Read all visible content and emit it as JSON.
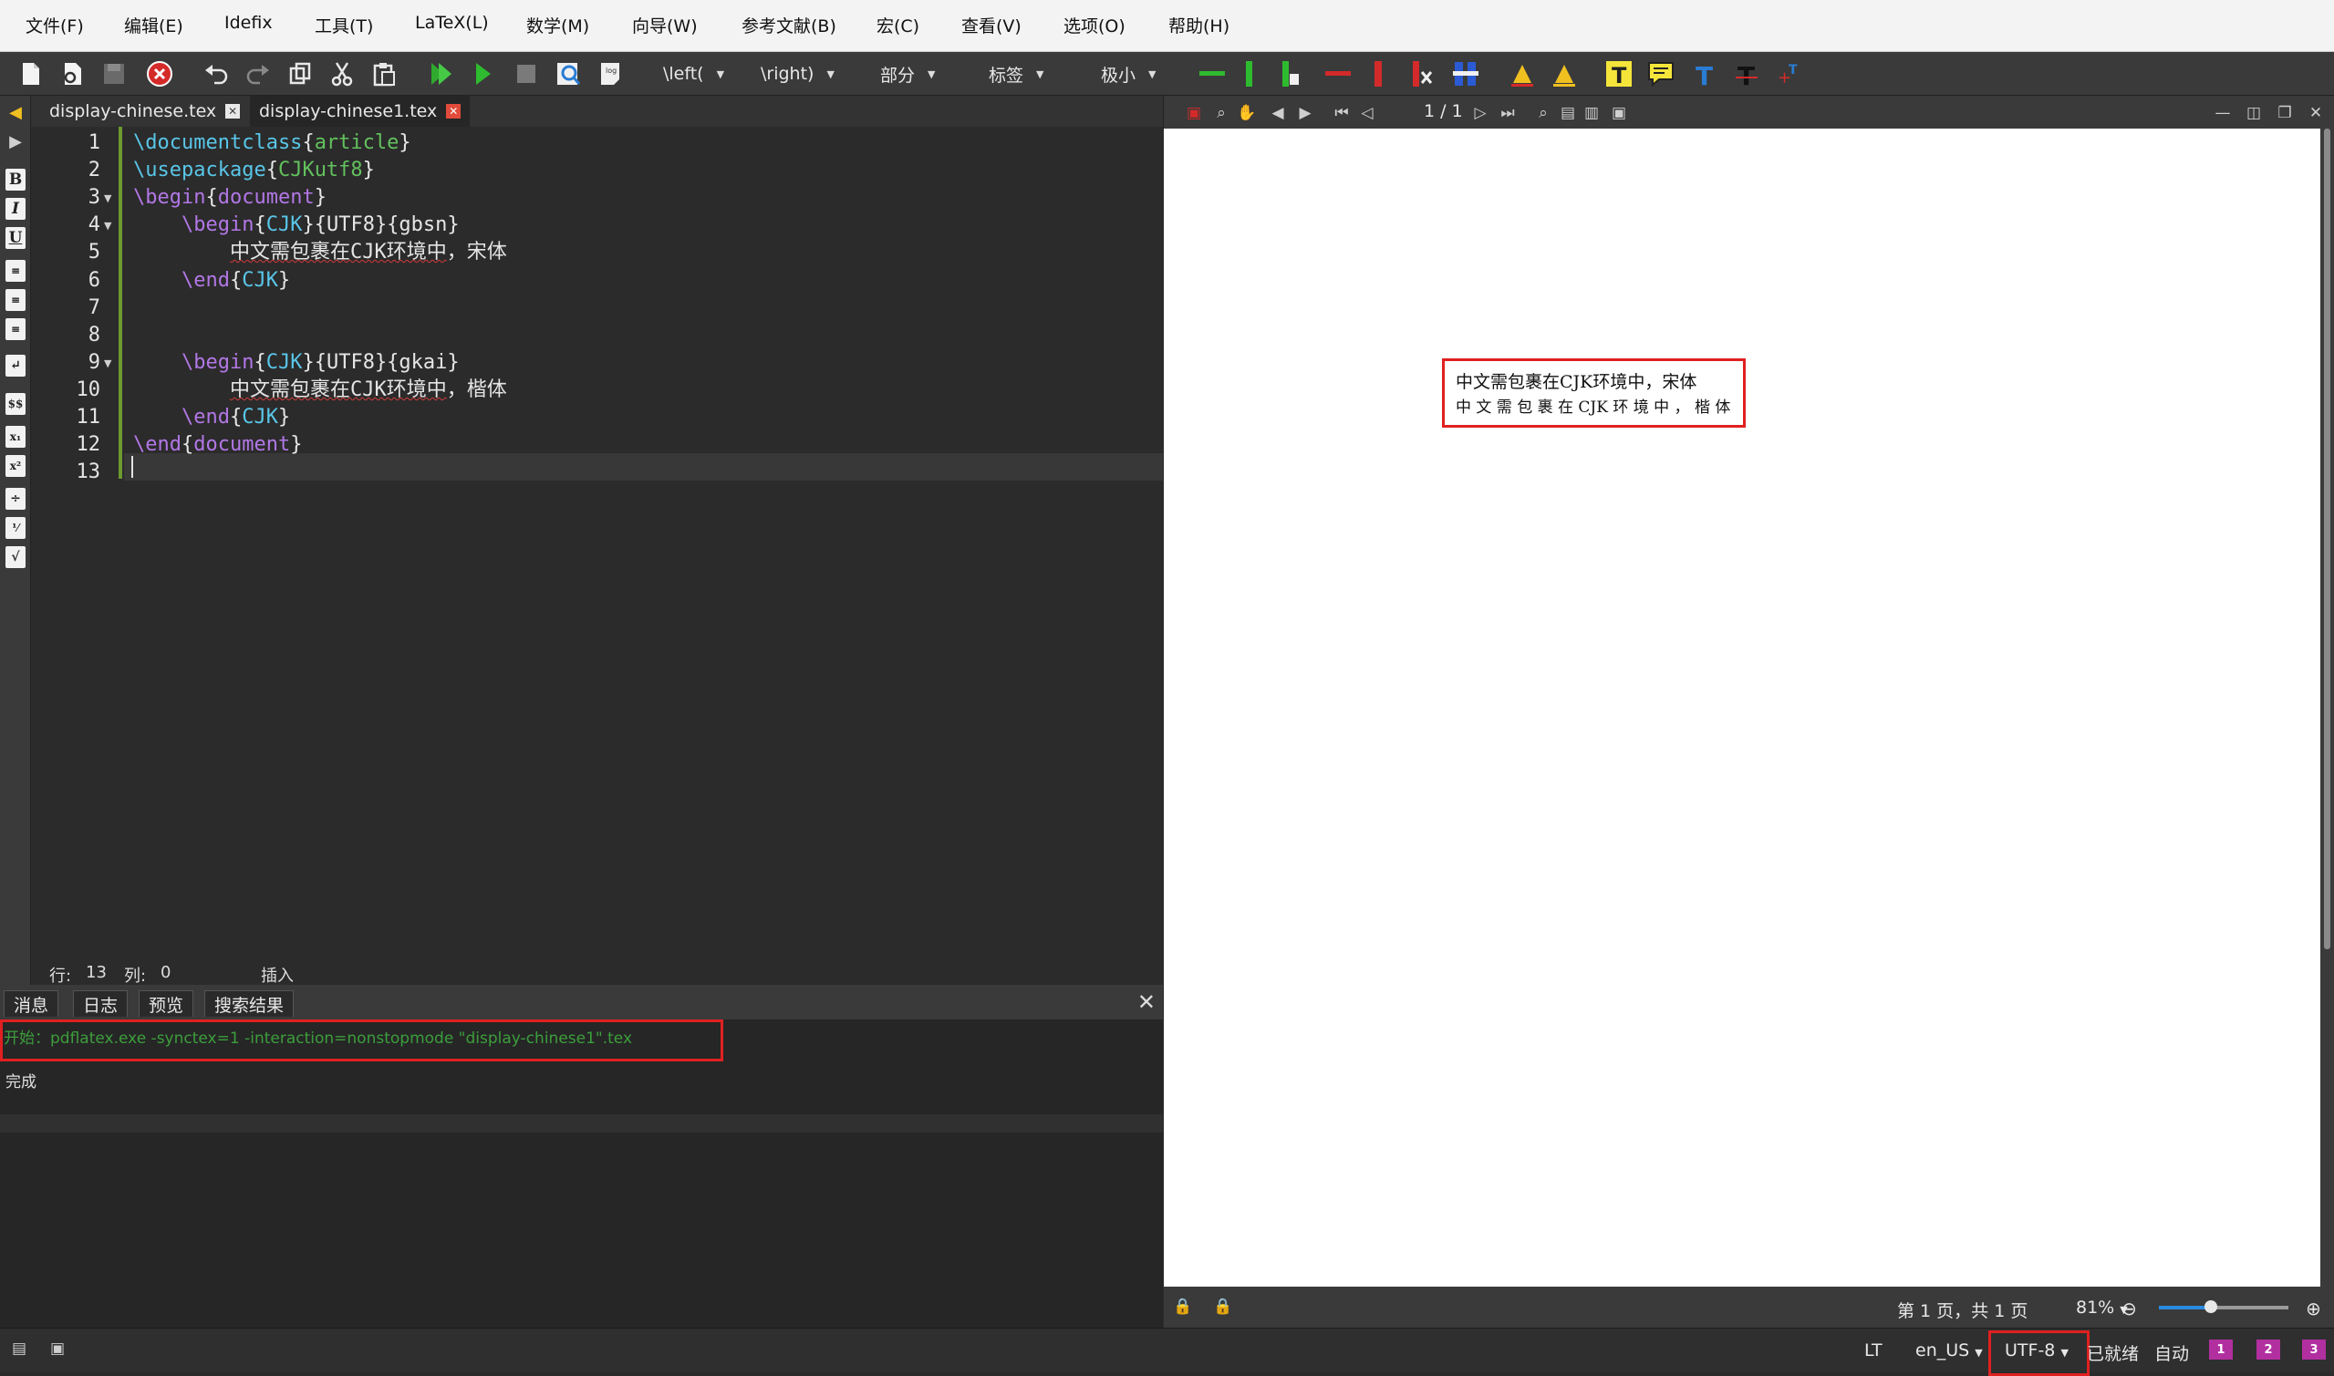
{
  "menu": [
    "文件(F)",
    "编辑(E)",
    "Idefix",
    "工具(T)",
    "LaTeX(L)",
    "数学(M)",
    "向导(W)",
    "参考文献(B)",
    "宏(C)",
    "查看(V)",
    "选项(O)",
    "帮助(H)"
  ],
  "toolbar": {
    "combos": [
      "\\left(",
      "\\right)",
      "部分",
      "标签",
      "极小"
    ]
  },
  "tabs": [
    {
      "label": "display-chinese.tex",
      "active": false
    },
    {
      "label": "display-chinese1.tex",
      "active": true
    }
  ],
  "editor": {
    "line_numbers": [
      "1",
      "2",
      "3",
      "4",
      "5",
      "6",
      "7",
      "8",
      "9",
      "10",
      "11",
      "12",
      "13"
    ],
    "lines": [
      [
        {
          "t": "\\documentclass",
          "c": "cmd"
        },
        {
          "t": "{",
          "c": "brk"
        },
        {
          "t": "article",
          "c": "arg"
        },
        {
          "t": "}",
          "c": "brk"
        }
      ],
      [
        {
          "t": "\\usepackage",
          "c": "cmd"
        },
        {
          "t": "{",
          "c": "brk"
        },
        {
          "t": "CJKutf8",
          "c": "arg"
        },
        {
          "t": "}",
          "c": "brk"
        }
      ],
      [
        {
          "t": "\\begin",
          "c": "env"
        },
        {
          "t": "{",
          "c": "brk"
        },
        {
          "t": "document",
          "c": "env"
        },
        {
          "t": "}",
          "c": "brk"
        }
      ],
      [
        {
          "t": "    ",
          "c": ""
        },
        {
          "t": "\\begin",
          "c": "env"
        },
        {
          "t": "{",
          "c": "brk"
        },
        {
          "t": "CJK",
          "c": "cmd"
        },
        {
          "t": "}{UTF8}{gbsn}",
          "c": "brk"
        }
      ],
      [
        {
          "t": "        ",
          "c": ""
        },
        {
          "t": "中文需包裹在CJK环境中",
          "c": "sq"
        },
        {
          "t": "，宋体",
          "c": ""
        }
      ],
      [
        {
          "t": "    ",
          "c": ""
        },
        {
          "t": "\\end",
          "c": "env"
        },
        {
          "t": "{",
          "c": "brk"
        },
        {
          "t": "CJK",
          "c": "cmd"
        },
        {
          "t": "}",
          "c": "brk"
        }
      ],
      [],
      [],
      [
        {
          "t": "    ",
          "c": ""
        },
        {
          "t": "\\begin",
          "c": "env"
        },
        {
          "t": "{",
          "c": "brk"
        },
        {
          "t": "CJK",
          "c": "cmd"
        },
        {
          "t": "}{UTF8}{gkai}",
          "c": "brk"
        }
      ],
      [
        {
          "t": "        ",
          "c": ""
        },
        {
          "t": "中文需包裹在CJK环境中",
          "c": "sq"
        },
        {
          "t": "，楷体",
          "c": ""
        }
      ],
      [
        {
          "t": "    ",
          "c": ""
        },
        {
          "t": "\\end",
          "c": "env"
        },
        {
          "t": "{",
          "c": "brk"
        },
        {
          "t": "CJK",
          "c": "cmd"
        },
        {
          "t": "}",
          "c": "brk"
        }
      ],
      [
        {
          "t": "\\end",
          "c": "env"
        },
        {
          "t": "{",
          "c": "brk"
        },
        {
          "t": "document",
          "c": "env"
        },
        {
          "t": "}",
          "c": "brk"
        }
      ],
      []
    ],
    "status": {
      "row_label": "行:",
      "row": "13",
      "col_label": "列:",
      "col": "0",
      "mode": "插入"
    }
  },
  "bottom_panel": {
    "tabs": [
      "消息",
      "日志",
      "预览",
      "搜索结果"
    ],
    "message": "开始：pdflatex.exe -synctex=1 -interaction=nonstopmode \"display-chinese1\".tex",
    "done": "完成"
  },
  "preview": {
    "page_indicator": "1 / 1",
    "output_lines": [
      "中文需包裹在CJK环境中，宋体",
      "中 文 需 包 裹 在 CJK 环 境 中 ， 楷 体"
    ],
    "page_status": "第 1 页，共 1 页",
    "zoom": "81%",
    "zoom_slider_level": 0.4
  },
  "statusbar": {
    "lt": "LT",
    "language": "en_US",
    "encoding": "UTF-8",
    "ready": "已就绪",
    "auto": "自动",
    "bookmarks": [
      "1",
      "2",
      "3"
    ]
  },
  "colors": {
    "highlight_box": "#e02020",
    "accent_green": "#6c9a2f",
    "msg_green": "#3c9e3c"
  }
}
